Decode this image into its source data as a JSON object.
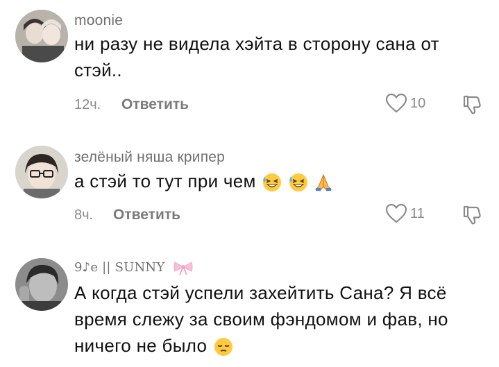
{
  "comments": [
    {
      "username": "moonie",
      "text": "ни разу не видела хэйта в сторону сана от стэй..",
      "time": "12ч.",
      "reply_label": "Ответить",
      "likes": "10",
      "emoji": []
    },
    {
      "username": "зелёный няша крипер",
      "text": "а стэй то тут при чем",
      "time": "8ч.",
      "reply_label": "Ответить",
      "likes": "11",
      "emoji": [
        "grinning-squinting-sweat",
        "grinning-squinting-sweat",
        "folded-hands"
      ]
    },
    {
      "username": "9♪e || SUNNY",
      "text": "А когда стэй успели захейтить Сана? Я всё время слежу за своим фэндомом и фав, но ничего не было",
      "emoji": [
        "pensive-face"
      ],
      "username_decoration": "ribbon-bow"
    }
  ],
  "icons": {
    "like": "heart-outline-icon",
    "dislike": "thumbs-down-outline-icon"
  },
  "colors": {
    "username": "#6f6f6f",
    "meta": "#8a8a8a",
    "text": "#111111",
    "bow": "#f4a6c6"
  }
}
